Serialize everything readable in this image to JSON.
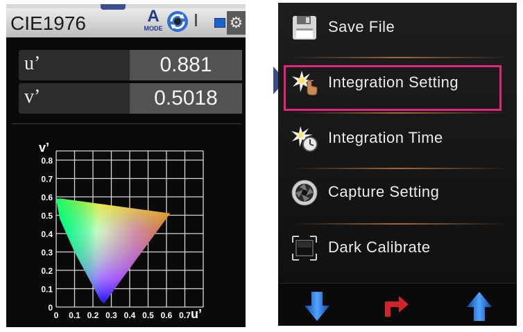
{
  "left_panel": {
    "title": "CIE1976",
    "mode_letter": "A",
    "mode_label": "MODE",
    "values": [
      {
        "label": "u’",
        "value": "0.881"
      },
      {
        "label": "v’",
        "value": "0.5018"
      }
    ],
    "diagram": {
      "y_axis_title": "v’",
      "x_axis_title": "u’",
      "y_ticks": [
        "0.8",
        "0.7",
        "0.6",
        "0.5",
        "0.4",
        "0.3",
        "0.2",
        "0.1",
        "0"
      ],
      "x_ticks": [
        "0",
        "0.1",
        "0.2",
        "0.3",
        "0.4",
        "0.5",
        "0.6",
        "0.7"
      ]
    }
  },
  "right_panel": {
    "menu": [
      {
        "label": "Save File",
        "icon": "floppy-disk-icon",
        "selected": false
      },
      {
        "label": "Integration Setting",
        "icon": "hand-pointer-icon",
        "selected": true
      },
      {
        "label": "Integration Time",
        "icon": "timer-icon",
        "selected": false
      },
      {
        "label": "Capture Setting",
        "icon": "camera-aperture-icon",
        "selected": false
      },
      {
        "label": "Dark Calibrate",
        "icon": "dark-frame-icon",
        "selected": false
      }
    ],
    "nav": [
      "arrow-down-icon",
      "return-arrow-icon",
      "arrow-up-icon"
    ]
  },
  "colors": {
    "highlight": "#e4237a",
    "pointer": "#3c4a8a",
    "nav_blue": "#1a6fd0",
    "nav_red": "#d2232a"
  }
}
